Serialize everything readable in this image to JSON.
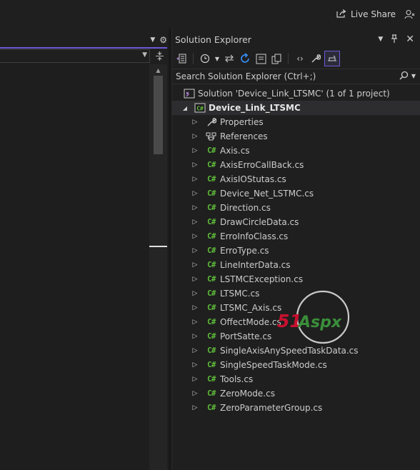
{
  "top_bar": {
    "live_share_label": "Live Share"
  },
  "solution_explorer": {
    "title": "Solution Explorer",
    "search_placeholder": "Search Solution Explorer (Ctrl+;)",
    "solution_label": "Solution 'Device_Link_LTSMC' (1 of 1 project)",
    "project_label": "Device_Link_LTSMC",
    "items": [
      {
        "label": "Properties",
        "icon": "wrench-icon"
      },
      {
        "label": "References",
        "icon": "references-icon"
      },
      {
        "label": "Axis.cs",
        "icon": "csharp-file-icon"
      },
      {
        "label": "AxisErroCallBack.cs",
        "icon": "csharp-file-icon"
      },
      {
        "label": "AxisIOStutas.cs",
        "icon": "csharp-file-icon"
      },
      {
        "label": "Device_Net_LSTMC.cs",
        "icon": "csharp-file-icon"
      },
      {
        "label": "Direction.cs",
        "icon": "csharp-file-icon"
      },
      {
        "label": "DrawCircleData.cs",
        "icon": "csharp-file-icon"
      },
      {
        "label": "ErroInfoClass.cs",
        "icon": "csharp-file-icon"
      },
      {
        "label": "ErroType.cs",
        "icon": "csharp-file-icon"
      },
      {
        "label": "LineInterData.cs",
        "icon": "csharp-file-icon"
      },
      {
        "label": "LSTMCException.cs",
        "icon": "csharp-file-icon"
      },
      {
        "label": "LTSMC.cs",
        "icon": "csharp-file-icon"
      },
      {
        "label": "LTSMC_Axis.cs",
        "icon": "csharp-file-icon"
      },
      {
        "label": "OffectMode.cs",
        "icon": "csharp-file-icon"
      },
      {
        "label": "PortSatte.cs",
        "icon": "csharp-file-icon"
      },
      {
        "label": "SingleAxisAnySpeedTaskData.cs",
        "icon": "csharp-file-icon"
      },
      {
        "label": "SingleSpeedTaskMode.cs",
        "icon": "csharp-file-icon"
      },
      {
        "label": "Tools.cs",
        "icon": "csharp-file-icon"
      },
      {
        "label": "ZeroMode.cs",
        "icon": "csharp-file-icon"
      },
      {
        "label": "ZeroParameterGroup.cs",
        "icon": "csharp-file-icon"
      }
    ],
    "csharp_badge": "C#"
  },
  "watermark": {
    "text": "51Aspx"
  },
  "colors": {
    "accent": "#6b5bd6",
    "csharp": "#5fbf3a",
    "background": "#1f1f1f"
  }
}
